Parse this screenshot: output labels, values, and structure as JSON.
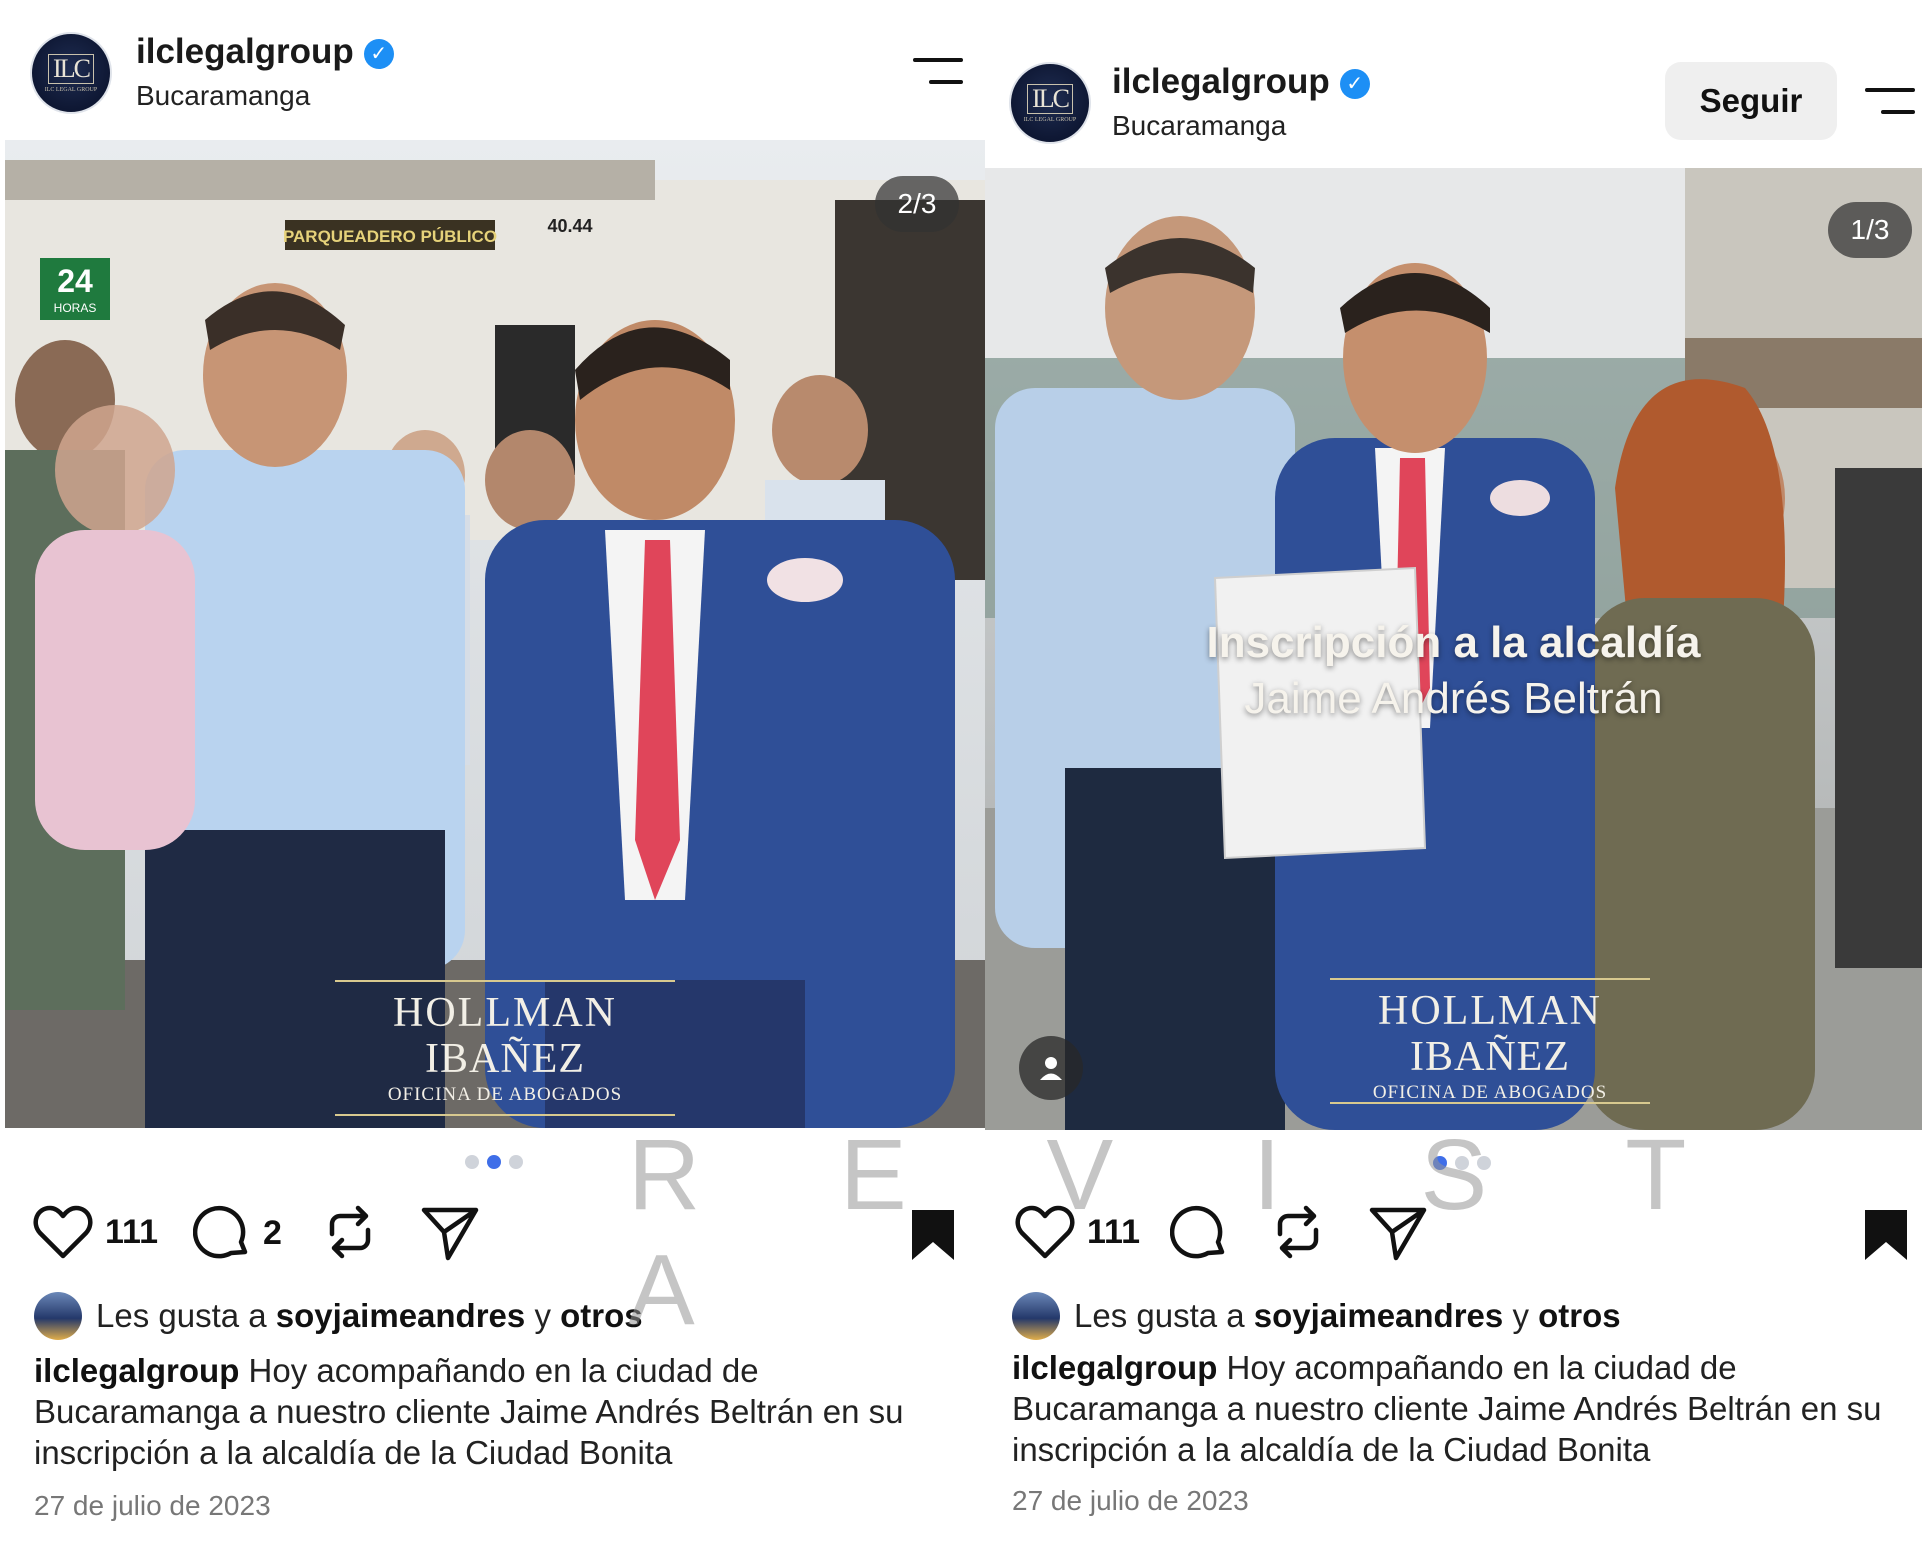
{
  "watermark_text": "R E V I S T A",
  "left_post": {
    "account": "ilclegalgroup",
    "verified": true,
    "location": "Bucaramanga",
    "avatar_text": "ILC",
    "avatar_subtext": "ILC LEGAL GROUP",
    "counter": "2/3",
    "photo_signs": {
      "parking": "PARQUEADERO PÚBLICO",
      "number": "40.44",
      "hours": "24",
      "hours_label": "HORAS"
    },
    "brand": {
      "line1": "HOLLMAN",
      "line2": "IBAÑEZ",
      "line3": "OFICINA DE ABOGADOS"
    },
    "likes_count": "111",
    "comments_count": "2",
    "liked_by_prefix": "Les gusta a",
    "liked_by_user": "soyjaimeandres",
    "liked_by_conj": "y",
    "liked_by_others": "otros",
    "caption_user": "ilclegalgroup",
    "caption_text": "Hoy acompañando en la ciudad de Bucaramanga a nuestro cliente Jaime Andrés Beltrán en su inscripción a la alcaldía de la Ciudad Bonita",
    "date": "27 de julio de 2023",
    "carousel_active": 2,
    "carousel_total": 3
  },
  "right_post": {
    "account": "ilclegalgroup",
    "verified": true,
    "location": "Bucaramanga",
    "avatar_text": "ILC",
    "avatar_subtext": "ILC LEGAL GROUP",
    "follow_label": "Seguir",
    "counter": "1/3",
    "overlay_title": "Inscripción a la alcaldía",
    "overlay_name": "Jaime Andrés Beltrán",
    "brand": {
      "line1": "HOLLMAN",
      "line2": "IBAÑEZ",
      "line3": "OFICINA DE ABOGADOS"
    },
    "likes_count": "111",
    "liked_by_prefix": "Les gusta a",
    "liked_by_user": "soyjaimeandres",
    "liked_by_conj": "y",
    "liked_by_others": "otros",
    "caption_user": "ilclegalgroup",
    "caption_text": "Hoy acompañando en la ciudad de Bucaramanga a nuestro cliente Jaime Andrés Beltrán en su inscripción a la alcaldía de la Ciudad Bonita",
    "date": "27 de julio de 2023",
    "carousel_active": 1,
    "carousel_total": 3
  },
  "icons": {
    "like": "heart-outline",
    "comment": "speech-bubble",
    "repost": "repost-arrows",
    "share": "paper-plane",
    "save": "bookmark-filled",
    "menu": "two-line-menu",
    "user_tag": "person-silhouette"
  },
  "colors": {
    "verified_blue": "#1d8ff5",
    "carousel_active": "#3f6ee8",
    "carousel_inactive": "#cfd3da",
    "follow_bg": "#efefef",
    "suit_blue": "#2f4f97",
    "tie_red": "#e0455a"
  }
}
